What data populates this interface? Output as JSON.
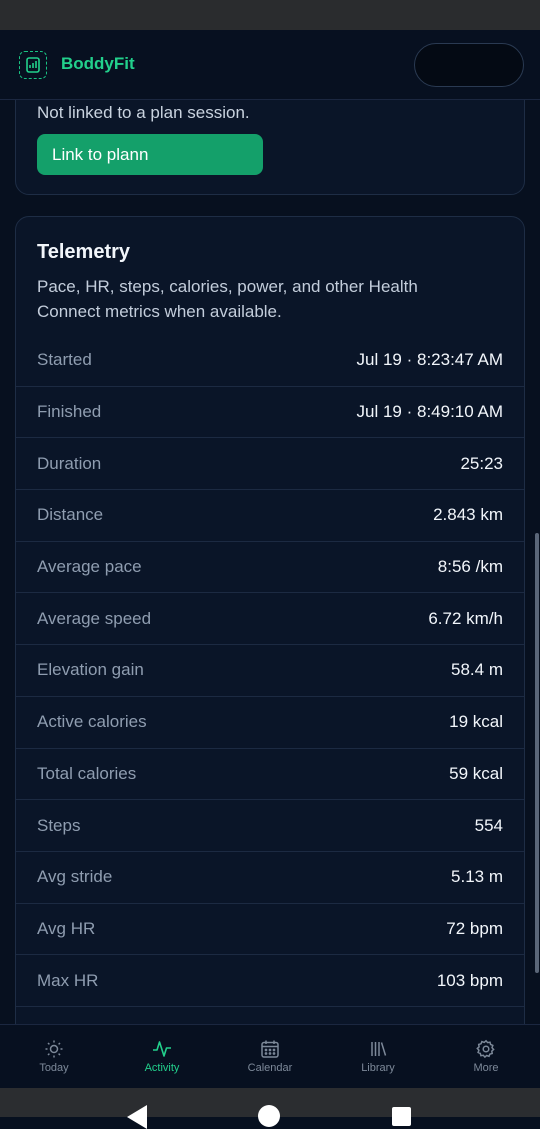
{
  "app": {
    "title": "BoddyFit"
  },
  "plan_card": {
    "status": "Not linked to a plan session.",
    "link_button": "Link to plann"
  },
  "telemetry": {
    "title": "Telemetry",
    "description": "Pace, HR, steps, calories, power, and other Health Connect metrics when available.",
    "rows": [
      {
        "label": "Started",
        "value": "Jul 19 · 8:23:47 AM"
      },
      {
        "label": "Finished",
        "value": "Jul 19 · 8:49:10 AM"
      },
      {
        "label": "Duration",
        "value": "25:23"
      },
      {
        "label": "Distance",
        "value": "2.843 km"
      },
      {
        "label": "Average pace",
        "value": "8:56 /km"
      },
      {
        "label": "Average speed",
        "value": "6.72 km/h"
      },
      {
        "label": "Elevation gain",
        "value": "58.4 m"
      },
      {
        "label": "Active calories",
        "value": "19 kcal"
      },
      {
        "label": "Total calories",
        "value": "59 kcal"
      },
      {
        "label": "Steps",
        "value": "554"
      },
      {
        "label": "Avg stride",
        "value": "5.13 m"
      },
      {
        "label": "Avg HR",
        "value": "72 bpm"
      },
      {
        "label": "Max HR",
        "value": "103 bpm"
      }
    ]
  },
  "bottom_nav": {
    "items": [
      {
        "label": "Today",
        "icon": "sun-icon"
      },
      {
        "label": "Activity",
        "icon": "pulse-icon"
      },
      {
        "label": "Calendar",
        "icon": "calendar-icon"
      },
      {
        "label": "Library",
        "icon": "library-icon"
      },
      {
        "label": "More",
        "icon": "gear-icon"
      }
    ],
    "active": "Activity"
  },
  "colors": {
    "accent": "#22d08c",
    "button": "#14a06a",
    "background": "#07101f",
    "card": "#0a1528"
  }
}
